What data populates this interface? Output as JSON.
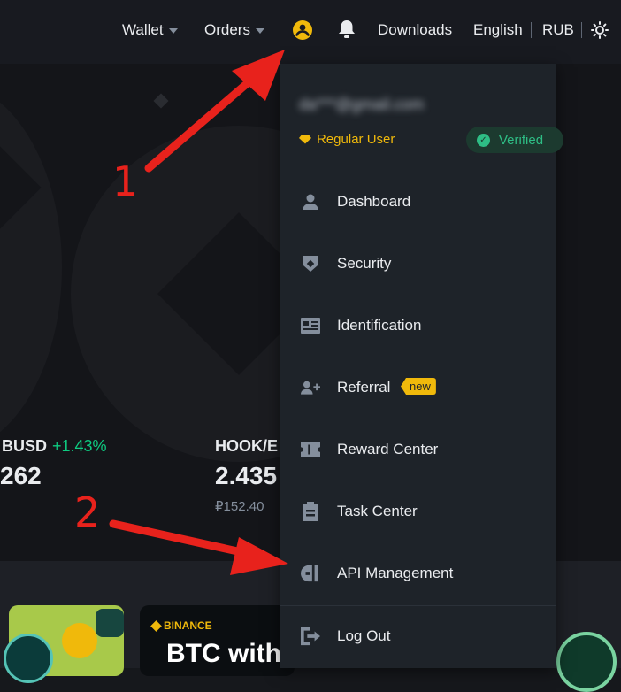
{
  "header": {
    "wallet_label": "Wallet",
    "orders_label": "Orders",
    "downloads_label": "Downloads",
    "language_label": "English",
    "currency_label": "RUB"
  },
  "hero": {
    "tickers": [
      {
        "name": "BUSD",
        "change": "+1.43%",
        "price": "262"
      },
      {
        "name": "HOOK/E",
        "price": "2.435",
        "sub": "₽152.40"
      }
    ]
  },
  "bottom": {
    "promo_brand": "BINANCE",
    "promo_text": "BTC with"
  },
  "menu": {
    "email": "da***@gmail.com",
    "user_level": "Regular User",
    "verified_label": "Verified",
    "items": [
      {
        "label": "Dashboard",
        "icon": "person-icon"
      },
      {
        "label": "Security",
        "icon": "shield-icon"
      },
      {
        "label": "Identification",
        "icon": "id-card-icon"
      },
      {
        "label": "Referral",
        "icon": "add-user-icon",
        "tag": "new"
      },
      {
        "label": "Reward Center",
        "icon": "ticket-icon"
      },
      {
        "label": "Task Center",
        "icon": "clipboard-icon"
      },
      {
        "label": "API Management",
        "icon": "api-icon"
      },
      {
        "label": "Log Out",
        "icon": "logout-icon"
      }
    ]
  },
  "annotations": {
    "step1": "1",
    "step2": "2"
  },
  "colors": {
    "accent": "#f0b90b",
    "verified": "#2ebd85",
    "arrow": "#e8221c"
  }
}
